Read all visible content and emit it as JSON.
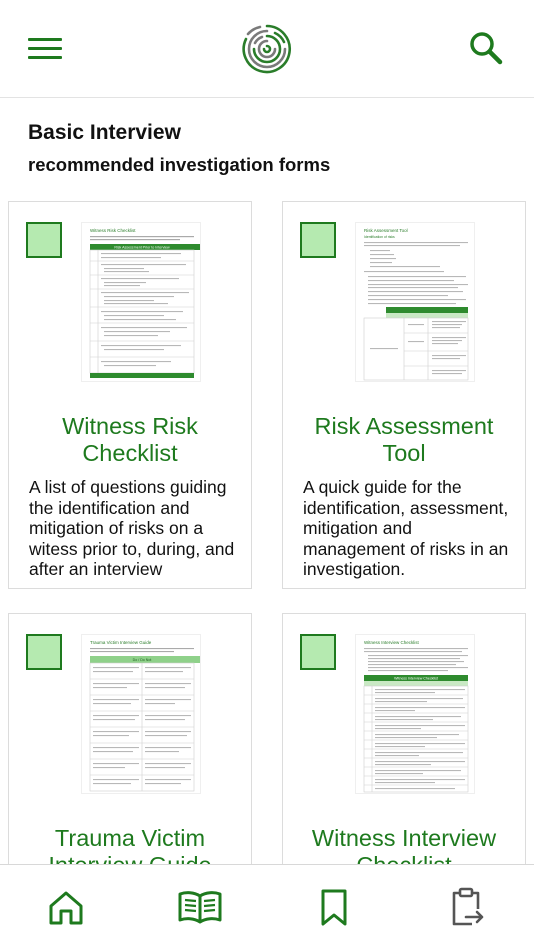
{
  "header": {
    "menu_icon": "hamburger-menu-icon",
    "logo_icon": "fingerprint-logo-icon",
    "search_icon": "search-icon",
    "accent_color": "#1e7a1e"
  },
  "page": {
    "title": "Basic Interview",
    "subtitle": "recommended investigation forms"
  },
  "cards": [
    {
      "title": "Witness Risk Checklist",
      "description": "A list of questions guiding the identification and mitigation of risks on a witess prior to, during, and after an interview",
      "thumb_heading": "Witness Risk Checklist",
      "thumb_table_header": "Risk Assessment Prior to Interview"
    },
    {
      "title": "Risk Assessment Tool",
      "description": "A quick guide for the identification, assessment, mitigation and management of risks in an investigation.",
      "thumb_heading": "Risk Assessment Tool",
      "thumb_table_header": "Identification of risks"
    },
    {
      "title": "Trauma Victim Interview Guide",
      "description": "",
      "thumb_heading": "Trauma Victim Interview Guide",
      "thumb_table_header": "Do / Do Not"
    },
    {
      "title": "Witness Interview Checklist",
      "description": "",
      "thumb_heading": "Witness Interview Checklist",
      "thumb_table_header": "Witness Interview Checklist"
    }
  ],
  "bottom_nav": [
    {
      "icon": "home-icon"
    },
    {
      "icon": "open-book-icon"
    },
    {
      "icon": "bookmark-icon"
    },
    {
      "icon": "clipboard-export-icon"
    }
  ]
}
